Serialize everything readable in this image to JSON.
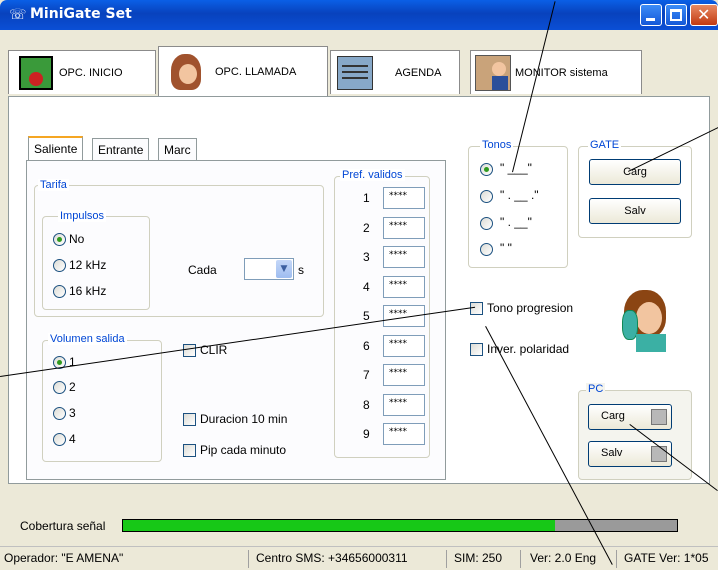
{
  "window": {
    "title": "MiniGate Set"
  },
  "main_tabs": [
    {
      "label": "OPC. INICIO"
    },
    {
      "label": "OPC. LLAMADA"
    },
    {
      "label": "AGENDA"
    },
    {
      "label": "MONITOR sistema"
    }
  ],
  "sub_tabs": [
    {
      "label": "Saliente"
    },
    {
      "label": "Entrante"
    },
    {
      "label": "Marc"
    }
  ],
  "tarifa": {
    "title": "Tarifa",
    "impulsos_title": "Impulsos",
    "options": [
      "No",
      "12 kHz",
      "16 kHz"
    ],
    "selected": "No",
    "cada_label": "Cada",
    "cada_unit": "s",
    "cada_value": ""
  },
  "volumen": {
    "title": "Volumen salida",
    "options": [
      "1",
      "2",
      "3",
      "4"
    ],
    "selected": "1"
  },
  "checks": {
    "clir": "CLIR",
    "duracion": "Duracion 10 min",
    "pip": "Pip cada minuto",
    "tono_progresion": "Tono progresion",
    "inver_polaridad": "Inver. polaridad"
  },
  "pref": {
    "title": "Pref. validos",
    "rows": [
      {
        "n": "1",
        "v": "****"
      },
      {
        "n": "2",
        "v": "****"
      },
      {
        "n": "3",
        "v": "****"
      },
      {
        "n": "4",
        "v": "****"
      },
      {
        "n": "5",
        "v": "****"
      },
      {
        "n": "6",
        "v": "****"
      },
      {
        "n": "7",
        "v": "****"
      },
      {
        "n": "8",
        "v": "****"
      },
      {
        "n": "9",
        "v": "****"
      }
    ]
  },
  "tonos": {
    "title": "Tonos",
    "options": [
      "\" ___\"",
      "\" . __ .\"",
      "\" . __\"",
      "\"      \""
    ],
    "selected_index": 0
  },
  "gate": {
    "title": "GATE",
    "carg": "Carg",
    "salv": "Salv"
  },
  "pc": {
    "title": "PC",
    "carg": "Carg",
    "salv": "Salv"
  },
  "coverage": {
    "label": "Cobertura señal",
    "level": 0.78
  },
  "status": {
    "operador": "Operador: \"E AMENA\"",
    "centro": "Centro SMS:  +34656000311",
    "sim": "SIM: 250",
    "ver": "Ver: 2.0  Eng",
    "gate_ver": "GATE Ver: 1*05"
  },
  "colors": {
    "title_blue": "#0a4fd6",
    "group_label": "#0046d5",
    "signal": "#17c817"
  }
}
